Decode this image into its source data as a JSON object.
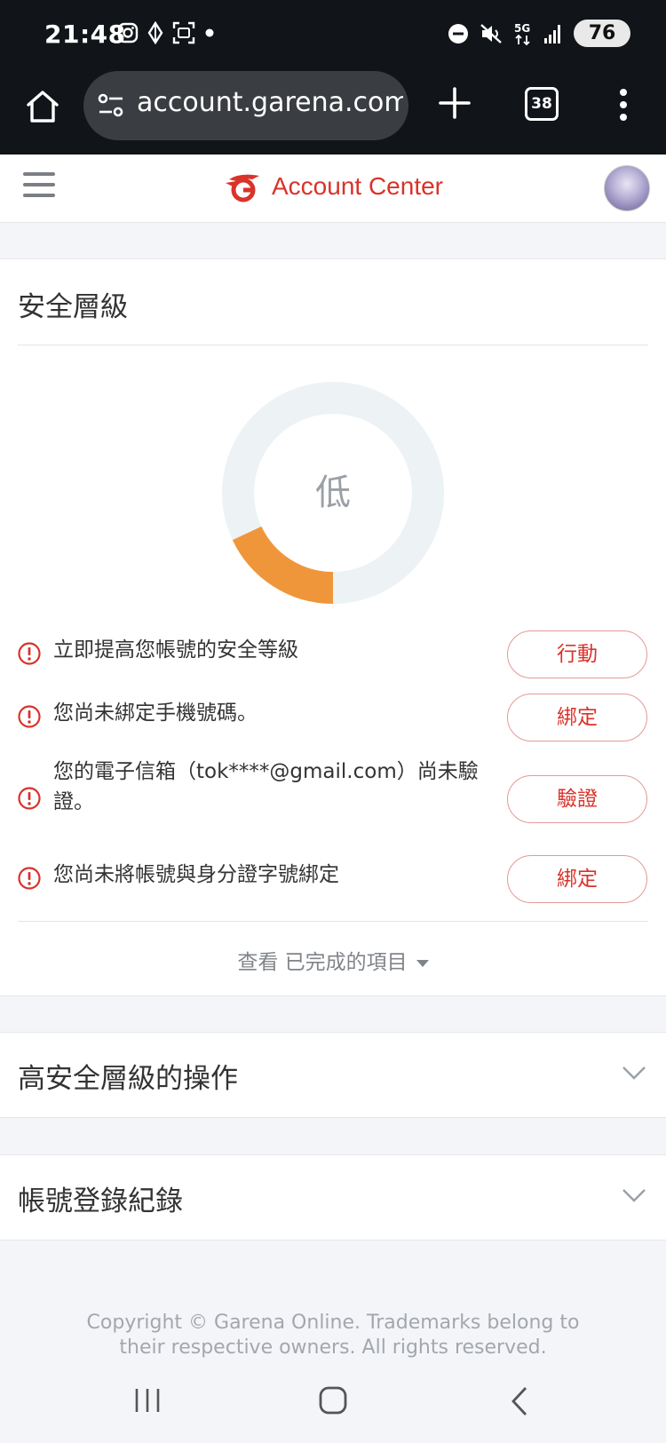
{
  "status_bar": {
    "time": "21:48",
    "battery": "76",
    "icons": [
      "instagram-icon",
      "signal-app-icon",
      "screenshot-icon",
      "notification-dot",
      "dnd-icon",
      "mute-icon",
      "5g-icon",
      "cell-signal-icon"
    ]
  },
  "browser": {
    "url": "account.garena.com",
    "tab_count": "38"
  },
  "header": {
    "title": "Account Center"
  },
  "security": {
    "title": "安全層級",
    "level_label": "低",
    "level_fraction": 0.18,
    "colors": {
      "progress": "#f0963a",
      "track": "#edf2f5"
    },
    "items": [
      {
        "text": "立即提高您帳號的安全等級",
        "action": "行動"
      },
      {
        "text": "您尚未綁定手機號碼。",
        "action": "綁定"
      },
      {
        "text": "您的電子信箱（tok****@gmail.com）尚未驗證。",
        "action": "驗證"
      },
      {
        "text": "您尚未將帳號與身分證字號綁定",
        "action": "綁定"
      }
    ],
    "view_completed": "查看 已完成的項目"
  },
  "sections": {
    "high_security_ops": "高安全層級的操作",
    "login_history": "帳號登錄紀錄"
  },
  "footer": {
    "copyright": "Copyright © Garena Online. Trademarks belong to their respective owners. All rights reserved."
  }
}
